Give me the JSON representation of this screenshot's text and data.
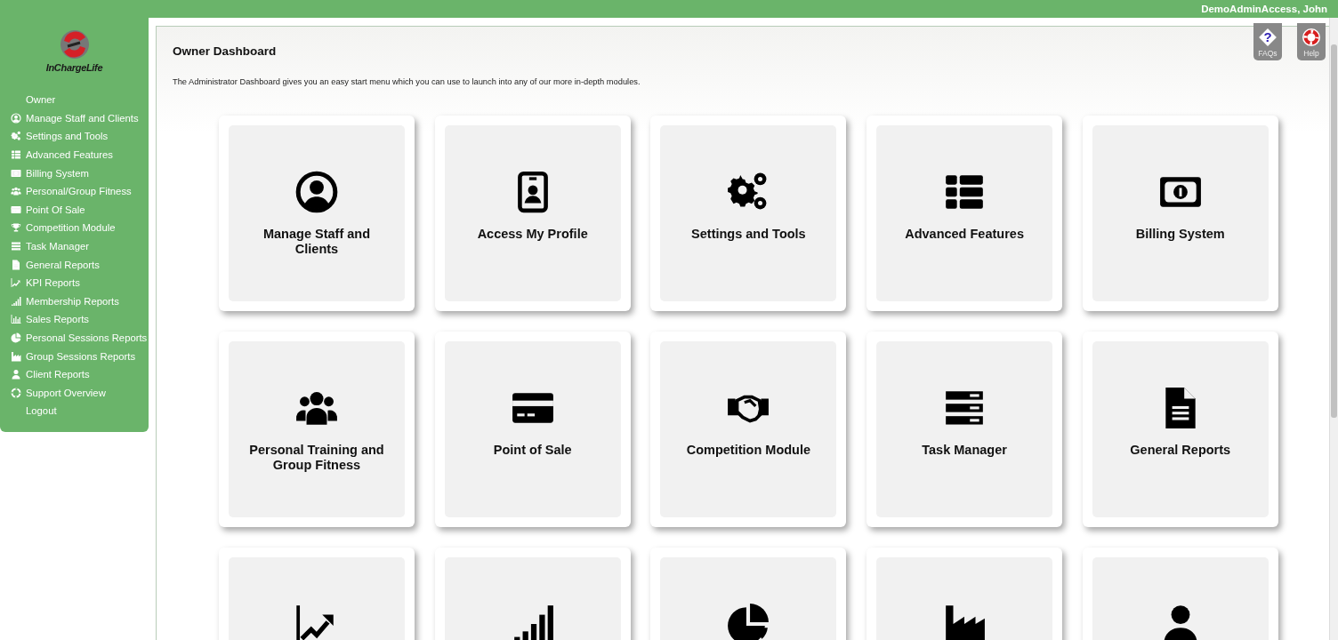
{
  "header": {
    "user": "DemoAdminAccess, John"
  },
  "sidebar": {
    "logo_text": "InChargeLife",
    "items": [
      {
        "label": "Owner",
        "kind": "none"
      },
      {
        "label": "Manage Staff and Clients",
        "kind": "user-circle"
      },
      {
        "label": "Settings and Tools",
        "kind": "gears"
      },
      {
        "label": "Advanced Features",
        "kind": "list"
      },
      {
        "label": "Billing System",
        "kind": "money"
      },
      {
        "label": "Personal/Group Fitness",
        "kind": "users"
      },
      {
        "label": "Point Of Sale",
        "kind": "card"
      },
      {
        "label": "Competition Module",
        "kind": "trophy"
      },
      {
        "label": "Task Manager",
        "kind": "tasks"
      },
      {
        "label": "General Reports",
        "kind": "file"
      },
      {
        "label": "KPI Reports",
        "kind": "line"
      },
      {
        "label": "Membership Reports",
        "kind": "signal"
      },
      {
        "label": "Sales Reports",
        "kind": "bars"
      },
      {
        "label": "Personal Sessions Reports",
        "kind": "pie"
      },
      {
        "label": "Group Sessions Reports",
        "kind": "area"
      },
      {
        "label": "Client Reports",
        "kind": "user"
      },
      {
        "label": "Support Overview",
        "kind": "support"
      },
      {
        "label": "Logout",
        "kind": "none"
      }
    ]
  },
  "help_buttons": [
    {
      "label": "FAQs",
      "kind": "faq",
      "symbol": "?"
    },
    {
      "label": "Help",
      "kind": "help"
    }
  ],
  "dashboard": {
    "title": "Owner Dashboard",
    "description": "The Administrator Dashboard gives you an easy start menu which you can use to launch into any of our more in-depth modules.",
    "cards": [
      {
        "label": "Manage Staff and Clients",
        "kind": "user-circle"
      },
      {
        "label": "Access My Profile",
        "kind": "badge"
      },
      {
        "label": "Settings and Tools",
        "kind": "gears"
      },
      {
        "label": "Advanced Features",
        "kind": "list"
      },
      {
        "label": "Billing System",
        "kind": "money"
      },
      {
        "label": "Personal Training and Group Fitness",
        "kind": "users"
      },
      {
        "label": "Point of Sale",
        "kind": "card"
      },
      {
        "label": "Competition Module",
        "kind": "handshake"
      },
      {
        "label": "Task Manager",
        "kind": "tasks"
      },
      {
        "label": "General Reports",
        "kind": "file"
      },
      {
        "kind": "line"
      },
      {
        "kind": "signal"
      },
      {
        "kind": "pie"
      },
      {
        "kind": "area"
      },
      {
        "kind": "user"
      }
    ]
  }
}
